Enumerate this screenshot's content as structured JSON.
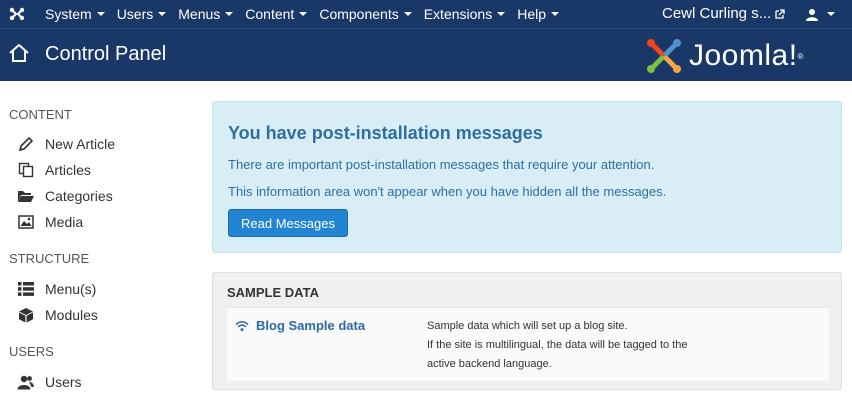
{
  "topbar": {
    "menu": [
      "System",
      "Users",
      "Menus",
      "Content",
      "Components",
      "Extensions",
      "Help"
    ],
    "site_name": "Cewl Curling s...",
    "user_icon": "user-icon"
  },
  "header": {
    "title": "Control Panel",
    "logo_text": "Joomla!",
    "logo_reg": "®"
  },
  "sidebar": {
    "sections": [
      {
        "heading": "CONTENT",
        "items": [
          "New Article",
          "Articles",
          "Categories",
          "Media"
        ]
      },
      {
        "heading": "STRUCTURE",
        "items": [
          "Menu(s)",
          "Modules"
        ]
      },
      {
        "heading": "USERS",
        "items": [
          "Users"
        ]
      }
    ]
  },
  "alert": {
    "title": "You have post-installation messages",
    "line1": "There are important post-installation messages that require your attention.",
    "line2": "This information area won't appear when you have hidden all the messages.",
    "button": "Read Messages"
  },
  "sample_data": {
    "heading": "SAMPLE DATA",
    "item_label": "Blog Sample data",
    "desc_line1": "Sample data which will set up a blog site.",
    "desc_line2": "If the site is multilingual, the data will be tagged to the",
    "desc_line3": "active backend language."
  },
  "colors": {
    "navbar": "#1a3867",
    "alert_bg": "#d9edf7",
    "alert_text": "#2f6f9f",
    "button": "#2384d3"
  }
}
